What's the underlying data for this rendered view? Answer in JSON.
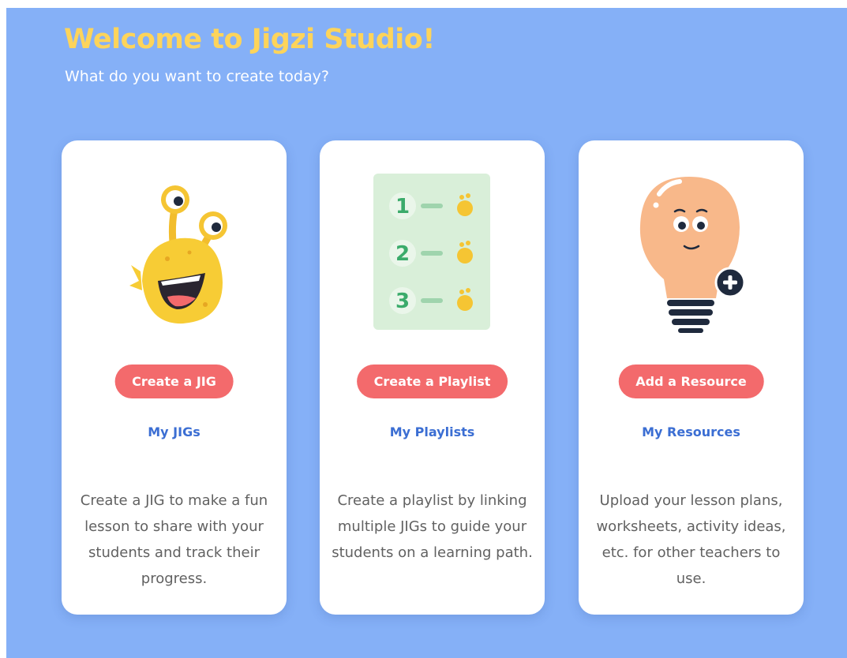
{
  "header": {
    "title": "Welcome to Jigzi Studio!",
    "subtitle": "What do you want to create today?"
  },
  "cards": [
    {
      "icon": "monster-icon",
      "button_label": "Create a JIG",
      "link_label": "My JIGs",
      "description": "Create a JIG to make a fun lesson to share with your students and track their progress."
    },
    {
      "icon": "numbered-list-icon",
      "button_label": "Create a Playlist",
      "link_label": "My Playlists",
      "description": "Create a playlist by linking multiple JIGs to guide your students on a learning path.",
      "list_numbers": [
        "1",
        "2",
        "3"
      ]
    },
    {
      "icon": "lightbulb-plus-icon",
      "button_label": "Add a Resource",
      "link_label": "My Resources",
      "description": "Upload your lesson plans, worksheets, activity ideas, etc. for other teachers to use."
    }
  ],
  "colors": {
    "background": "#85b0f7",
    "title": "#fdd45b",
    "button": "#f36a6c",
    "link": "#3b6ed3",
    "text": "#616161"
  }
}
